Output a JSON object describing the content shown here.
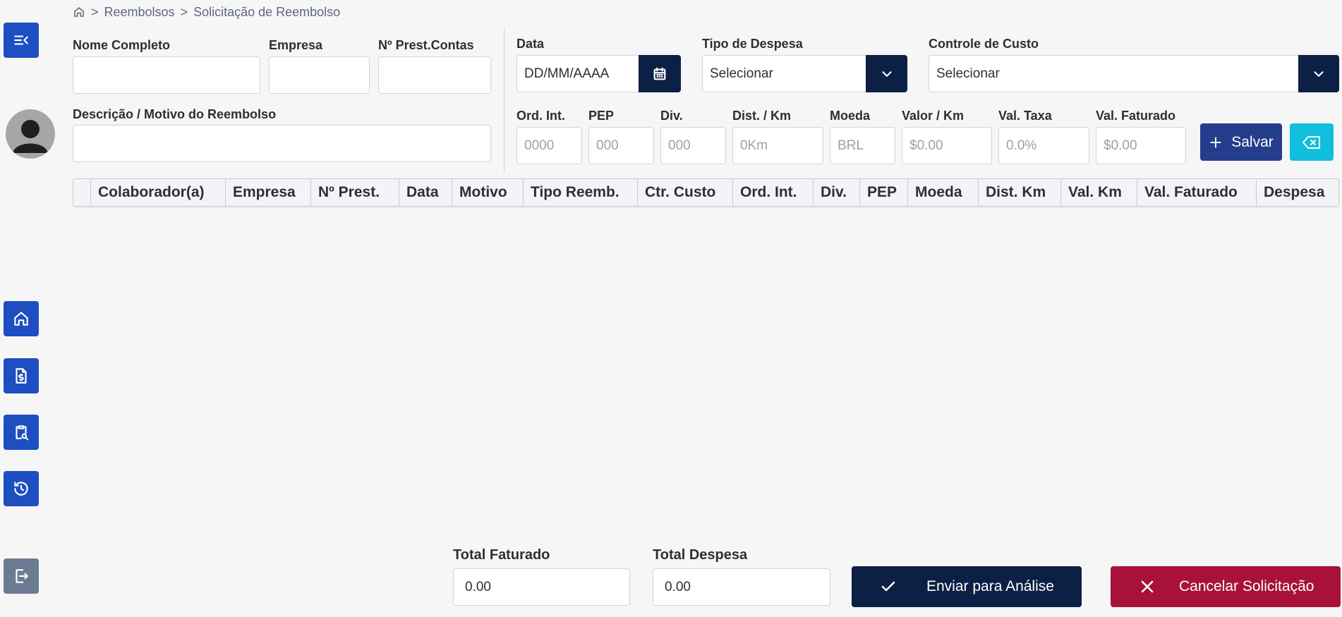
{
  "breadcrumb": {
    "sep1": ">",
    "item1": "Reembolsos",
    "sep2": ">",
    "item2": "Solicitação de Reembolso"
  },
  "form": {
    "nome_completo": {
      "label": "Nome Completo",
      "value": ""
    },
    "empresa": {
      "label": "Empresa",
      "value": ""
    },
    "prest_contas": {
      "label": "Nº Prest.Contas",
      "value": ""
    },
    "descricao": {
      "label": "Descrição / Motivo do Reembolso",
      "value": ""
    },
    "data": {
      "label": "Data",
      "placeholder": "DD/MM/AAAA"
    },
    "tipo_despesa": {
      "label": "Tipo de Despesa",
      "value": "Selecionar"
    },
    "controle_custo": {
      "label": "Controle de Custo",
      "value": "Selecionar"
    },
    "ord_int": {
      "label": "Ord. Int.",
      "placeholder": "0000"
    },
    "pep": {
      "label": "PEP",
      "placeholder": "000"
    },
    "div": {
      "label": "Div.",
      "placeholder": "000"
    },
    "dist_km": {
      "label": "Dist. / Km",
      "placeholder": "0Km"
    },
    "moeda": {
      "label": "Moeda",
      "placeholder": "BRL"
    },
    "valor_km": {
      "label": "Valor / Km",
      "placeholder": "$0.00"
    },
    "val_taxa": {
      "label": "Val. Taxa",
      "placeholder": "0.0%"
    },
    "val_faturado": {
      "label": "Val. Faturado",
      "placeholder": "$0.00"
    },
    "salvar_label": "Salvar"
  },
  "table": {
    "columns": [
      "Colaborador(a)",
      "Empresa",
      "Nº Prest.",
      "Data",
      "Motivo",
      "Tipo Reemb.",
      "Ctr. Custo",
      "Ord. Int.",
      "Div.",
      "PEP",
      "Moeda",
      "Dist. Km",
      "Val. Km",
      "Val. Faturado",
      "Despesa"
    ],
    "rows": []
  },
  "footer": {
    "total_faturado": {
      "label": "Total Faturado",
      "value": "0.00"
    },
    "total_despesa": {
      "label": "Total Despesa",
      "value": "0.00"
    },
    "enviar_label": "Enviar para Análise",
    "cancelar_label": "Cancelar Solicitação"
  },
  "colors": {
    "primary": "#1d4ec2",
    "dark": "#0c1f44",
    "salvar": "#243d8c",
    "clear": "#0fbfdc",
    "cancel": "#a8123a",
    "logout": "#6b7b91"
  },
  "icons": [
    "collapse-menu-icon",
    "home-icon",
    "document-dollar-icon",
    "clipboard-search-icon",
    "history-icon",
    "logout-icon",
    "calendar-icon",
    "chevron-down-icon",
    "plus-icon",
    "backspace-icon",
    "check-icon",
    "close-icon"
  ]
}
